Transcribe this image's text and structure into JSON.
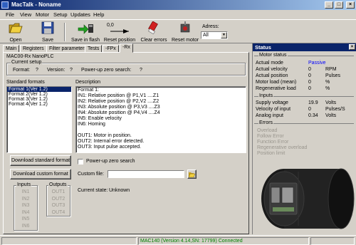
{
  "window": {
    "title": "MacTalk - Noname"
  },
  "menu": [
    "File",
    "View",
    "Motor",
    "Setup",
    "Updates",
    "Help"
  ],
  "toolbar": {
    "open": "Open",
    "save": "Save",
    "save_flash": "Save in flash",
    "reset_position": "Reset position",
    "reset_position_value": "0,0",
    "clear_errors": "Clear errors",
    "reset_motor": "Reset motor",
    "address_label": "Adress:",
    "address_value": "All"
  },
  "tabs": [
    "Main",
    "Registers",
    "Filter parameters",
    "Tests",
    "-FPx",
    "-Rx"
  ],
  "active_tab": "-Rx",
  "main": {
    "module_title": "MAC00-Rx NanoPLC",
    "current_setup": {
      "title": "Current setup",
      "format_label": "Format:",
      "format_value": "?",
      "version_label": "Version:",
      "version_value": "?",
      "powerup_label": "Power-up zero search:",
      "powerup_value": "?"
    },
    "standard_formats_label": "Standard formats",
    "formats": [
      "Format 1(Ver 1.2)",
      "Format 2(Ver 1.2)",
      "Format 3(Ver 1.2)",
      "Format 4(Ver 1.2)"
    ],
    "description_label": "Description",
    "description_lines": [
      "Format 1:",
      "IN1: Relative position @ P1,V1 ....Z1",
      "IN2: Relative position @ P2,V2 ....Z2",
      "IN3: Absolute position @ P3,V3 ....Z3",
      "IN4: Absolute position @ P4,V4 ....Z4",
      "IN5: Enable velocity",
      "IN6: Homing",
      "",
      "OUT1: Motor in position.",
      "OUT2: Internal error detected.",
      "OUT3: Input pulse accepted."
    ],
    "download_standard": "Download standard format",
    "download_custom": "Download custom format",
    "powerup_checkbox": "Power-up zero search",
    "custom_file_label": "Custom file:",
    "custom_file_value": "",
    "current_state_label": "Current state:",
    "current_state_value": "Unknown",
    "inputs_title": "Inputs",
    "inputs": [
      "IN1",
      "IN2",
      "IN3",
      "IN4",
      "IN5",
      "IN6"
    ],
    "outputs_title": "Outputs",
    "outputs": [
      "OUT1",
      "OUT2",
      "OUT3",
      "OUT4"
    ]
  },
  "status": {
    "title": "Status",
    "motor_status_title": "Motor status",
    "motor_rows": [
      {
        "label": "Actual mode",
        "value": "Passive",
        "unit": ""
      },
      {
        "label": "Actual velocity",
        "value": "0",
        "unit": "RPM"
      },
      {
        "label": "Actual position",
        "value": "0",
        "unit": "Pulses"
      },
      {
        "label": "Motor load (mean)",
        "value": "0",
        "unit": "%"
      },
      {
        "label": "Regenerative load",
        "value": "0",
        "unit": "%"
      }
    ],
    "inputs_title": "Inputs",
    "input_rows": [
      {
        "label": "Supply voltage",
        "value": "19.9",
        "unit": "Volts"
      },
      {
        "label": "Velocity of input",
        "value": "0",
        "unit": "Pulses/S"
      },
      {
        "label": "Analog input",
        "value": "0.34",
        "unit": "Volts"
      }
    ],
    "errors_title": "Errors",
    "errors": [
      "Overload",
      "Follow Error",
      "Function Error",
      "Regenerative overload",
      "Position limit"
    ],
    "passive_color": "#0000ff"
  },
  "statusbar": {
    "connection": "MAC140 (Version 4.14,SN: 17799) Connected",
    "connection_color": "#008000"
  }
}
